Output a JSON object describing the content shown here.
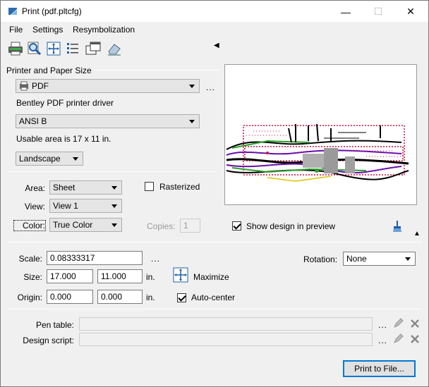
{
  "window": {
    "title": "Print  (pdf.pltcfg)",
    "minimize_glyph": "—",
    "maximize_glyph": "☐",
    "close_glyph": "✕"
  },
  "menu": {
    "items": [
      {
        "label": "File"
      },
      {
        "label": "Settings"
      },
      {
        "label": "Resymbolization"
      }
    ]
  },
  "toolbar": {
    "icons": [
      "printer-icon",
      "preview-zoom-icon",
      "fit-icon",
      "list-icon",
      "window-icon",
      "eraser-icon"
    ],
    "collapse_glyph": "◀"
  },
  "printer": {
    "section_label": "Printer and Paper Size",
    "printer_value": "PDF",
    "more_label": "...",
    "driver_text": "Bentley PDF printer driver",
    "paper_value": "ANSI B",
    "usable_area": "Usable area is 17 x 11 in.",
    "orientation_value": "Landscape"
  },
  "options": {
    "area_label": "Area:",
    "area_value": "Sheet",
    "view_label": "View:",
    "view_value": "View 1",
    "color_label": "Color:",
    "color_value": "True Color",
    "rasterized_label": "Rasterized",
    "rasterized_checked": false,
    "copies_label": "Copies:",
    "copies_value": "1",
    "show_design_label": "Show design in preview",
    "show_design_checked": true,
    "expand_glyph": "▲"
  },
  "layout": {
    "scale_label": "Scale:",
    "scale_value": "0.08333317",
    "scale_more": "...",
    "rotation_label": "Rotation:",
    "rotation_value": "None",
    "size_label": "Size:",
    "size_w": "17.000",
    "size_h": "11.000",
    "size_unit": "in.",
    "maximize_label": "Maximize",
    "origin_label": "Origin:",
    "origin_x": "0.000",
    "origin_y": "0.000",
    "origin_unit": "in.",
    "autocenter_label": "Auto-center",
    "autocenter_checked": true
  },
  "scripts": {
    "pen_table_label": "Pen table:",
    "pen_table_value": "",
    "design_script_label": "Design script:",
    "design_script_value": "",
    "more_label": "..."
  },
  "actions": {
    "print_button": "Print to File..."
  }
}
